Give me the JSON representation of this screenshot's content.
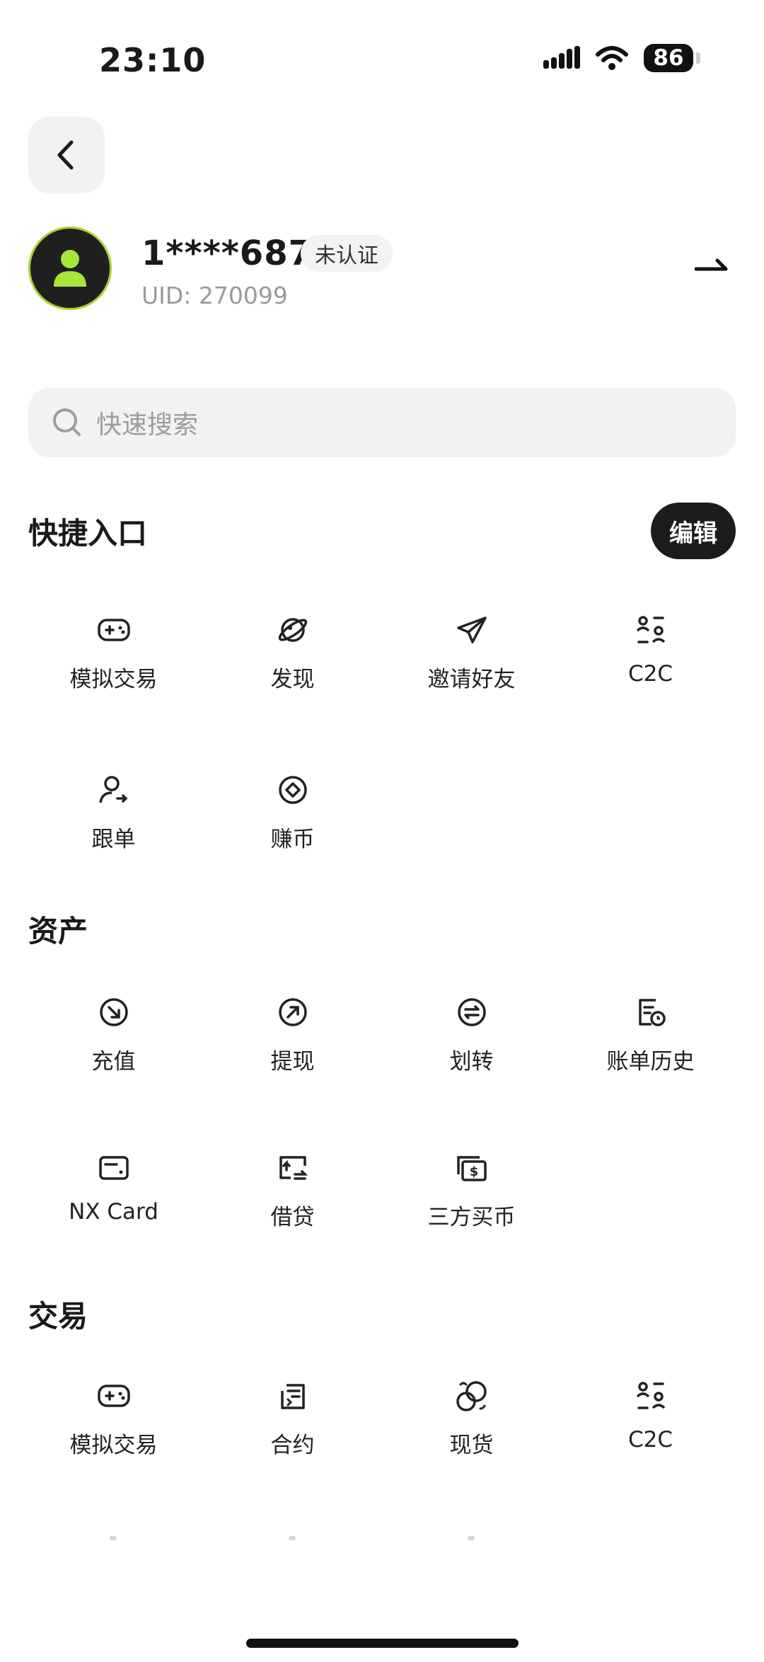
{
  "status_bar": {
    "time": "23:10",
    "battery": "86"
  },
  "profile": {
    "username": "1****687",
    "badge": "未认证",
    "uid": "UID: 270099"
  },
  "search": {
    "placeholder": "快速搜索"
  },
  "sections": {
    "shortcuts": {
      "title": "快捷入口",
      "edit_label": "编辑",
      "items": [
        {
          "label": "模拟交易",
          "icon": "gamepad-icon"
        },
        {
          "label": "发现",
          "icon": "planet-icon"
        },
        {
          "label": "邀请好友",
          "icon": "paper-plane-icon"
        },
        {
          "label": "C2C",
          "icon": "c2c-users-icon"
        },
        {
          "label": "跟单",
          "icon": "copy-trade-user-icon"
        },
        {
          "label": "赚币",
          "icon": "earn-coin-icon"
        }
      ]
    },
    "assets": {
      "title": "资产",
      "items": [
        {
          "label": "充值",
          "icon": "deposit-arrow-icon"
        },
        {
          "label": "提现",
          "icon": "withdraw-arrow-icon"
        },
        {
          "label": "划转",
          "icon": "transfer-icon"
        },
        {
          "label": "账单历史",
          "icon": "bill-history-icon"
        },
        {
          "label": "NX Card",
          "icon": "card-icon"
        },
        {
          "label": "借贷",
          "icon": "loan-icon"
        },
        {
          "label": "三方买币",
          "icon": "third-party-buy-icon"
        }
      ]
    },
    "trade": {
      "title": "交易",
      "items": [
        {
          "label": "模拟交易",
          "icon": "gamepad-icon"
        },
        {
          "label": "合约",
          "icon": "contract-document-icon"
        },
        {
          "label": "现货",
          "icon": "spot-coins-icon"
        },
        {
          "label": "C2C",
          "icon": "c2c-users-icon"
        }
      ]
    }
  },
  "colors": {
    "accent": "#a8d32e",
    "background": "#ffffff",
    "dark": "#1c1c1c"
  }
}
